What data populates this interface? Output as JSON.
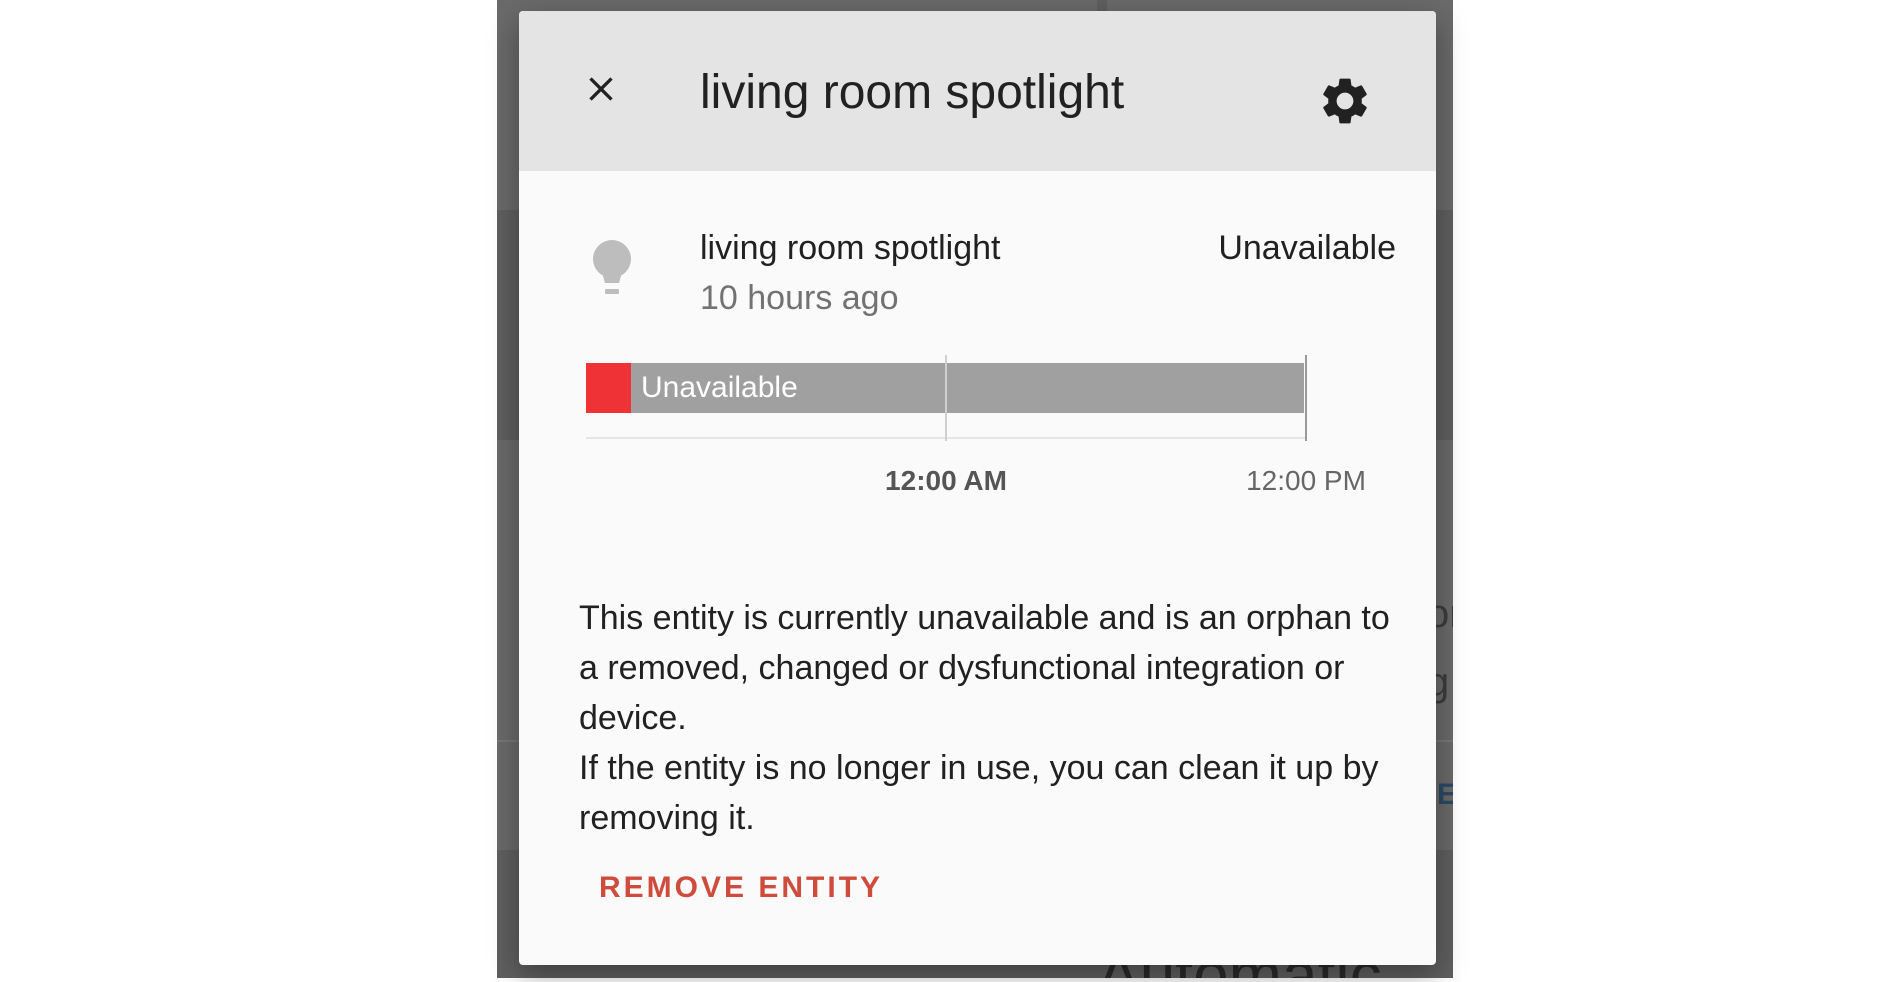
{
  "dialog": {
    "title": "living room spotlight",
    "close_icon": "close-icon",
    "settings_icon": "gear-icon"
  },
  "entity": {
    "icon": "lightbulb-icon",
    "name": "living room spotlight",
    "last_changed": "10 hours ago",
    "state": "Unavailable"
  },
  "history": {
    "bar_label": "Unavailable",
    "colors": {
      "unavailable_segment": "#ee3236",
      "state_bar": "#a0a0a0"
    },
    "axis_labels": [
      {
        "text": "12:00 AM",
        "bold": true
      },
      {
        "text": "12:00 PM",
        "bold": false
      }
    ]
  },
  "message": {
    "line1": "This entity is currently unavailable and is an orphan to a removed, changed or dysfunctional integration or device.",
    "line2": "If the entity is no longer in use, you can clean it up by removing it."
  },
  "actions": {
    "remove_label": "REMOVE ENTITY",
    "accent_color": "#cf4b3c"
  },
  "background": {
    "partial_text_1": "or",
    "partial_text_2": "g",
    "partial_link": "E",
    "partial_heading": "Automatic"
  }
}
